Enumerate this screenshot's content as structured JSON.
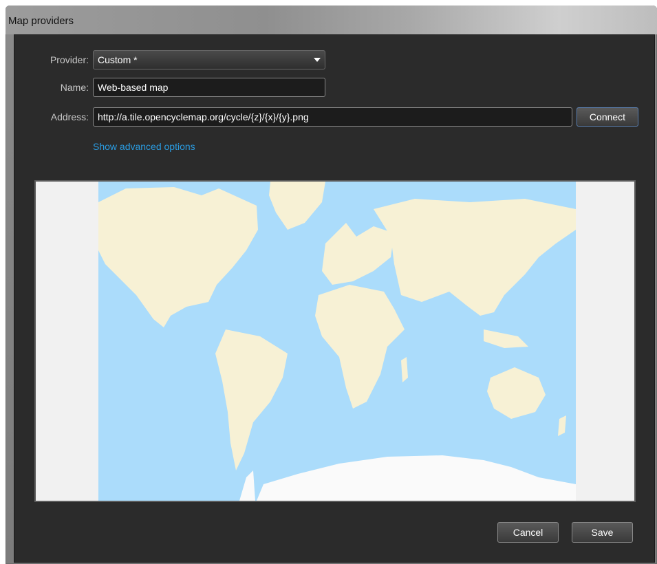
{
  "window": {
    "title": "Map providers"
  },
  "form": {
    "provider_label": "Provider:",
    "provider_value": "Custom *",
    "name_label": "Name:",
    "name_value": "Web-based map",
    "address_label": "Address:",
    "address_value": "http://a.tile.opencyclemap.org/cycle/{z}/{x}/{y}.png",
    "connect_label": "Connect",
    "advanced_link": "Show advanced options"
  },
  "map": {
    "ocean_color": "#abdcfb",
    "land_color": "#f7f1d5",
    "ice_color": "#fafafa",
    "margin_color": "#f1f1f1"
  },
  "footer": {
    "cancel_label": "Cancel",
    "save_label": "Save"
  },
  "colors": {
    "accent_link": "#2a9be0",
    "dialog_bg": "#2b2b2b"
  }
}
